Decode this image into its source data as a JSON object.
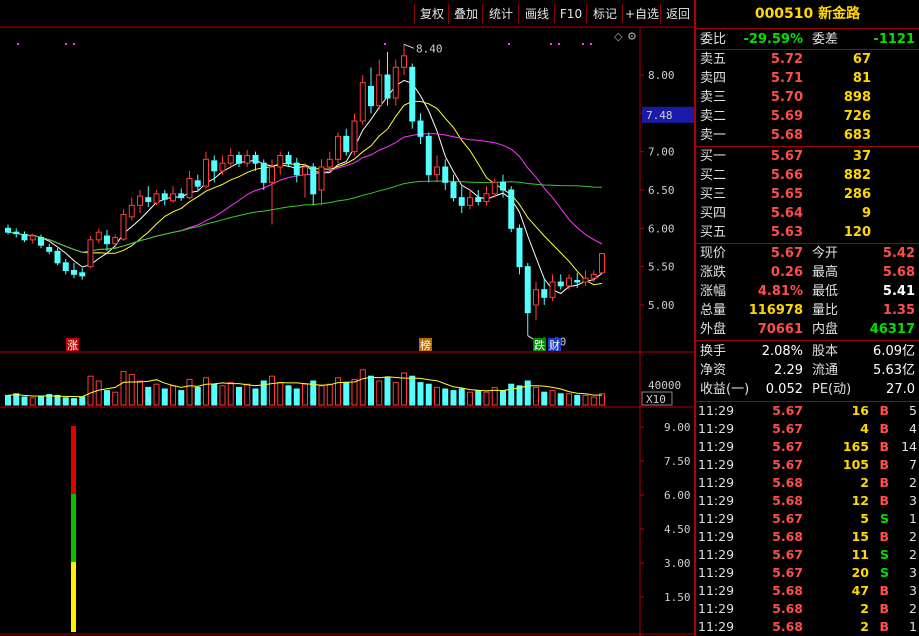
{
  "toolbar": {
    "buttons": [
      "复权",
      "叠加",
      "统计",
      "画线",
      "F10",
      "标记",
      "+自选",
      "返回"
    ]
  },
  "chart": {
    "price_axis": [
      "8.00",
      "7.50",
      "7.00",
      "6.50",
      "6.00",
      "5.50",
      "5.00"
    ],
    "current_price_tag": "7.48",
    "high_marker": "8.40",
    "low_marker": "4.60",
    "markers": [
      {
        "text": "涨"
      },
      {
        "text": "榜"
      },
      {
        "text": "跌"
      },
      {
        "text": "财"
      }
    ],
    "volume_axis_label": "40000",
    "volume_unit": "X10",
    "indicator_axis": [
      "9.00",
      "7.50",
      "6.00",
      "4.50",
      "3.00",
      "1.50"
    ],
    "colors": {
      "up": "#ff3b3b",
      "down": "#54ffff",
      "ma5": "#ffffff",
      "ma10": "#ffff33",
      "ma20": "#ff33ff",
      "ma60": "#33cc33",
      "frame": "#b00000"
    }
  },
  "quote": {
    "code": "000510",
    "name": "新金路",
    "weibi_label": "委比",
    "weibi_value": "-29.59%",
    "weicha_label": "委差",
    "weicha_value": "-1121",
    "sells": [
      {
        "label": "卖五",
        "price": "5.72",
        "vol": "67"
      },
      {
        "label": "卖四",
        "price": "5.71",
        "vol": "81"
      },
      {
        "label": "卖三",
        "price": "5.70",
        "vol": "898"
      },
      {
        "label": "卖二",
        "price": "5.69",
        "vol": "726"
      },
      {
        "label": "卖一",
        "price": "5.68",
        "vol": "683"
      }
    ],
    "buys": [
      {
        "label": "买一",
        "price": "5.67",
        "vol": "37"
      },
      {
        "label": "买二",
        "price": "5.66",
        "vol": "882"
      },
      {
        "label": "买三",
        "price": "5.65",
        "vol": "286"
      },
      {
        "label": "买四",
        "price": "5.64",
        "vol": "9"
      },
      {
        "label": "买五",
        "price": "5.63",
        "vol": "120"
      }
    ],
    "stats": [
      {
        "l1": "现价",
        "v1": "5.67",
        "c1": "red",
        "l2": "今开",
        "v2": "5.42",
        "c2": "red"
      },
      {
        "l1": "涨跌",
        "v1": "0.26",
        "c1": "red",
        "l2": "最高",
        "v2": "5.68",
        "c2": "red"
      },
      {
        "l1": "涨幅",
        "v1": "4.81%",
        "c1": "red",
        "l2": "最低",
        "v2": "5.41",
        "c2": "white"
      },
      {
        "l1": "总量",
        "v1": "116978",
        "c1": "yellow",
        "l2": "量比",
        "v2": "1.35",
        "c2": "red"
      },
      {
        "l1": "外盘",
        "v1": "70661",
        "c1": "red",
        "l2": "内盘",
        "v2": "46317",
        "c2": "green"
      }
    ],
    "stats2": [
      {
        "l1": "换手",
        "v1": "2.08%",
        "l2": "股本",
        "v2": "6.09亿"
      },
      {
        "l1": "净资",
        "v1": "2.29",
        "l2": "流通",
        "v2": "5.63亿"
      },
      {
        "l1": "收益(一)",
        "v1": "0.052",
        "l2": "PE(动)",
        "v2": "27.0"
      }
    ],
    "ticks": [
      {
        "time": "11:29",
        "price": "5.67",
        "vol": "16",
        "side": "B",
        "n": "5"
      },
      {
        "time": "11:29",
        "price": "5.67",
        "vol": "4",
        "side": "B",
        "n": "4"
      },
      {
        "time": "11:29",
        "price": "5.67",
        "vol": "165",
        "side": "B",
        "n": "14"
      },
      {
        "time": "11:29",
        "price": "5.67",
        "vol": "105",
        "side": "B",
        "n": "7"
      },
      {
        "time": "11:29",
        "price": "5.68",
        "vol": "2",
        "side": "B",
        "n": "2"
      },
      {
        "time": "11:29",
        "price": "5.68",
        "vol": "12",
        "side": "B",
        "n": "3"
      },
      {
        "time": "11:29",
        "price": "5.67",
        "vol": "5",
        "side": "S",
        "n": "1"
      },
      {
        "time": "11:29",
        "price": "5.68",
        "vol": "15",
        "side": "B",
        "n": "2"
      },
      {
        "time": "11:29",
        "price": "5.67",
        "vol": "11",
        "side": "S",
        "n": "2"
      },
      {
        "time": "11:29",
        "price": "5.67",
        "vol": "20",
        "side": "S",
        "n": "3"
      },
      {
        "time": "11:29",
        "price": "5.68",
        "vol": "47",
        "side": "B",
        "n": "3"
      },
      {
        "time": "11:29",
        "price": "5.68",
        "vol": "2",
        "side": "B",
        "n": "2"
      },
      {
        "time": "11:29",
        "price": "5.68",
        "vol": "2",
        "side": "B",
        "n": "1"
      }
    ]
  }
}
